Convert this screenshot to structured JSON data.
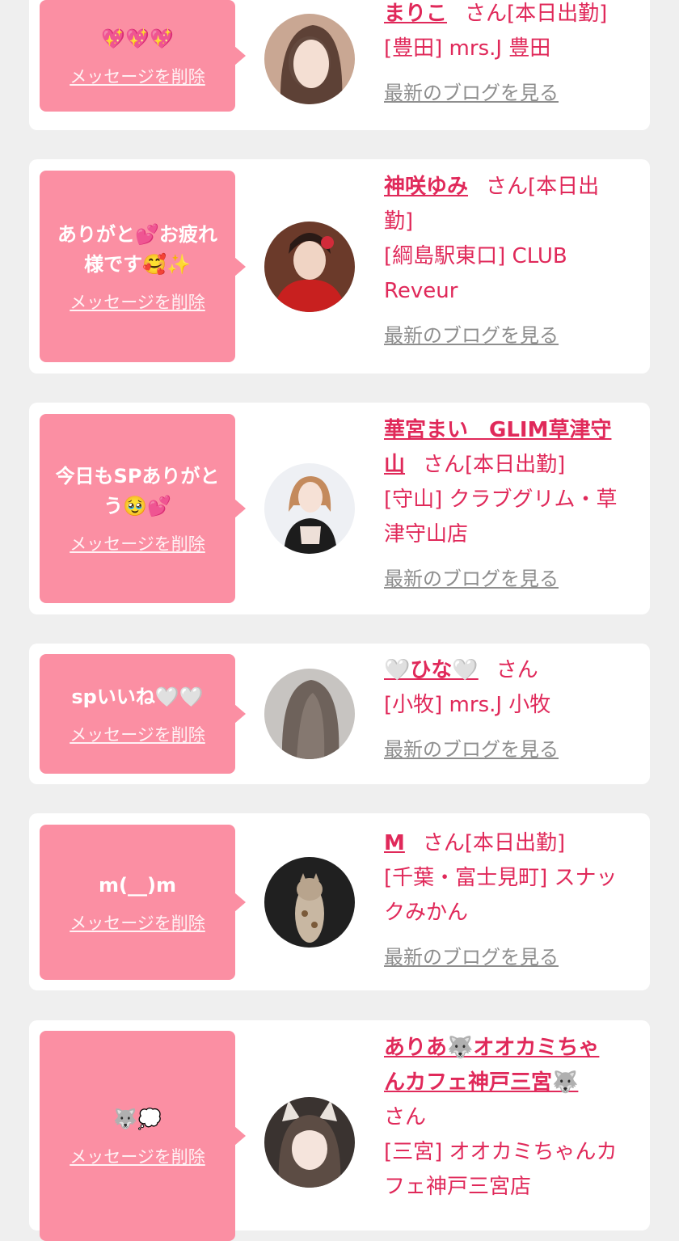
{
  "cards": [
    {
      "message": "💖💖💖",
      "delete_label": "メッセージを削除",
      "name": "まりこ",
      "suffix": "さん[本日出勤]",
      "shop": "[豊田] mrs.J 豊田",
      "blog_label": "最新のブログを見る"
    },
    {
      "message": "ありがと💕お疲れ\n様です🥰✨",
      "delete_label": "メッセージを削除",
      "name": "神咲ゆみ",
      "suffix": "さん[本日出\n勤]",
      "shop": "[綱島駅東口] CLUB\nReveur",
      "blog_label": "最新のブログを見る"
    },
    {
      "message": "今日もSPありがと\nう🥹💕",
      "delete_label": "メッセージを削除",
      "name": "華宮まい　GLIM草津守\n山",
      "suffix": "さん[本日出勤]",
      "shop": "[守山] クラブグリム・草\n津守山店",
      "blog_label": "最新のブログを見る"
    },
    {
      "message": "spいいね🤍🤍",
      "delete_label": "メッセージを削除",
      "name": "🤍ひな🤍",
      "suffix": "さん",
      "shop": "[小牧] mrs.J 小牧",
      "blog_label": "最新のブログを見る"
    },
    {
      "message": "m(__)m",
      "delete_label": "メッセージを削除",
      "name": "M",
      "suffix": "さん[本日出勤]",
      "shop": "[千葉・富士見町] スナッ\nクみかん",
      "blog_label": "最新のブログを見る"
    },
    {
      "message": "🐺💭",
      "delete_label": "メッセージを削除",
      "name": "ありあ🐺オオカミちゃ\nんカフェ神戸三宮🐺",
      "suffix": "さん",
      "shop": "[三宮] オオカミちゃんカ\nフェ神戸三宮店",
      "blog_label": ""
    }
  ],
  "colors": {
    "accent": "#e0295a",
    "bubble": "#fb8fa3",
    "background": "#efefef",
    "link_gray": "#8e8e8e"
  }
}
